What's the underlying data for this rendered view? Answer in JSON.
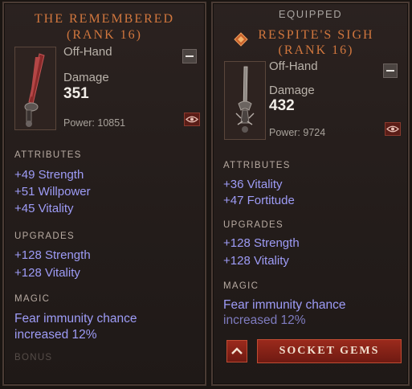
{
  "left": {
    "title": "THE REMEMBERED",
    "rank": "(RANK 16)",
    "slot": "Off-Hand",
    "damage_label": "Damage",
    "damage_value": "351",
    "power": "Power: 10851",
    "attributes_label": "ATTRIBUTES",
    "attributes": [
      "+49 Strength",
      "+51 Willpower",
      "+45 Vitality"
    ],
    "upgrades_label": "UPGRADES",
    "upgrades": [
      "+128 Strength",
      "+128 Vitality"
    ],
    "magic_label": "MAGIC",
    "magic_lines": [
      "Fear immunity chance",
      "increased 12%"
    ],
    "bonus_label": "BONUS"
  },
  "right": {
    "equipped_label": "EQUIPPED",
    "title": "RESPITE'S SIGH",
    "rank": "(RANK 16)",
    "slot": "Off-Hand",
    "damage_label": "Damage",
    "damage_value": "432",
    "power": "Power: 9724",
    "attributes_label": "ATTRIBUTES",
    "attributes": [
      "+36 Vitality",
      "+47 Fortitude"
    ],
    "upgrades_label": "UPGRADES",
    "upgrades": [
      "+128 Strength",
      "+128 Vitality"
    ],
    "magic_label": "MAGIC",
    "magic_lines": [
      "Fear immunity chance",
      "increased 12%"
    ],
    "socket_button": "SOCKET GEMS"
  },
  "icons": {
    "collapse": "minus-icon",
    "inspect": "eye-icon",
    "expand": "chevron-up-icon",
    "rank": "rank-diamond-icon"
  },
  "colors": {
    "title": "#d2773e",
    "stat": "#9e9cf7",
    "button_red": "#8a2318"
  }
}
